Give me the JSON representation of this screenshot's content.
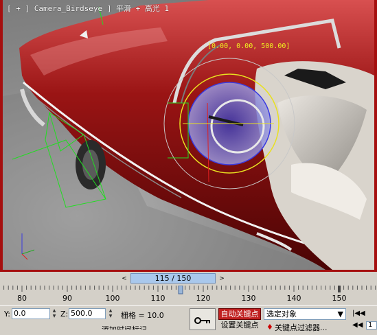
{
  "viewport": {
    "label": "[ + ] Camera_Birdseye ] 平滑 + 高光 1",
    "coords": "[0.00, 0.00, 500.00]",
    "border_color": "#a50f0f"
  },
  "timeline": {
    "frame_display": "115 / 150",
    "ticks": [
      80,
      90,
      100,
      110,
      120,
      130,
      140,
      150
    ],
    "current_frame": 115,
    "total_frames": 150,
    "prev_arrow": "<",
    "next_arrow": ">"
  },
  "status": {
    "y_label": "Y:",
    "y_value": "0.0",
    "z_label": "Z:",
    "z_value": "500.0",
    "grid_text": "栅格 = 10.0",
    "auto_key_label": "自动关键点",
    "set_key_label": "设置关键点",
    "selection_value": "选定对象",
    "key_filter_label": "关键点过滤器...",
    "bottom_left_text": "添加时间标记",
    "frame_field": "1"
  }
}
